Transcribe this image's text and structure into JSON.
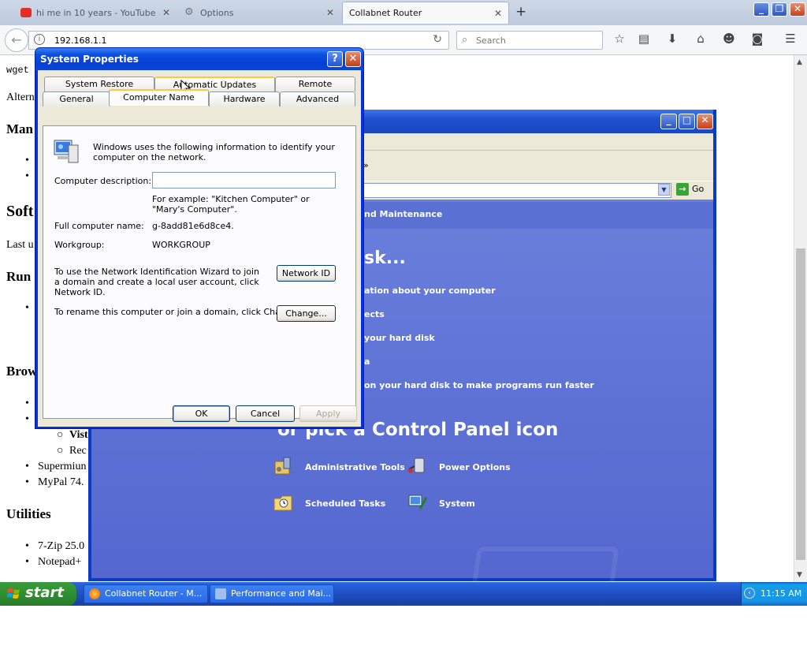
{
  "browser": {
    "tabs": [
      {
        "title": "hi me in 10 years - YouTube"
      },
      {
        "title": "Options"
      },
      {
        "title": "Collabnet Router"
      }
    ],
    "url": "192.168.1.1",
    "search_placeholder": "Search"
  },
  "webpage": {
    "line1": "wget",
    "line2": "Altern",
    "h1": "Man",
    "h2": "Soft",
    "line3": "Last u",
    "h3": "Run",
    "h4": "Brow",
    "sub1": "Vist",
    "sub2": "Rec",
    "item1": "Supermiun",
    "item2": "MyPal 74.",
    "h5": "Utilities",
    "item3": "7-Zip 25.0",
    "item4": "Notepad+"
  },
  "perf_window": {
    "band_text": "nd Maintenance",
    "pick_task": "sk...",
    "tasks": [
      "ation about your computer",
      "ects",
      " your hard disk",
      "a",
      " on your hard disk to make programs run faster"
    ],
    "pick_icon": "or pick a Control Panel icon",
    "icons": [
      {
        "label": "Administrative Tools"
      },
      {
        "label": "Power Options"
      },
      {
        "label": "Scheduled Tasks"
      },
      {
        "label": "System"
      }
    ],
    "go_label": "Go",
    "menu_arrow": "»"
  },
  "dialog": {
    "title": "System Properties",
    "tabs_row1": [
      "System Restore",
      "Automatic Updates",
      "Remote"
    ],
    "tabs_row2": [
      "General",
      "Computer Name",
      "Hardware",
      "Advanced"
    ],
    "intro": "Windows uses the following information to identify your computer on the network.",
    "desc_label": "Computer description:",
    "desc_value": "",
    "example": "For example: \"Kitchen Computer\" or \"Mary's Computer\".",
    "full_name_label": "Full computer name:",
    "full_name_value": "g-8add81e6d8ce4.",
    "workgroup_label": "Workgroup:",
    "workgroup_value": "WORKGROUP",
    "network_text": "To use the Network Identification Wizard to join a domain and create a local user account, click Network ID.",
    "network_btn": "Network ID",
    "rename_text": "To rename this computer or join a domain, click Change.",
    "change_btn": "Change...",
    "ok": "OK",
    "cancel": "Cancel",
    "apply": "Apply"
  },
  "taskbar": {
    "start": "start",
    "items": [
      "Collabnet Router - M...",
      "Performance and Mai..."
    ],
    "clock": "11:15 AM"
  }
}
